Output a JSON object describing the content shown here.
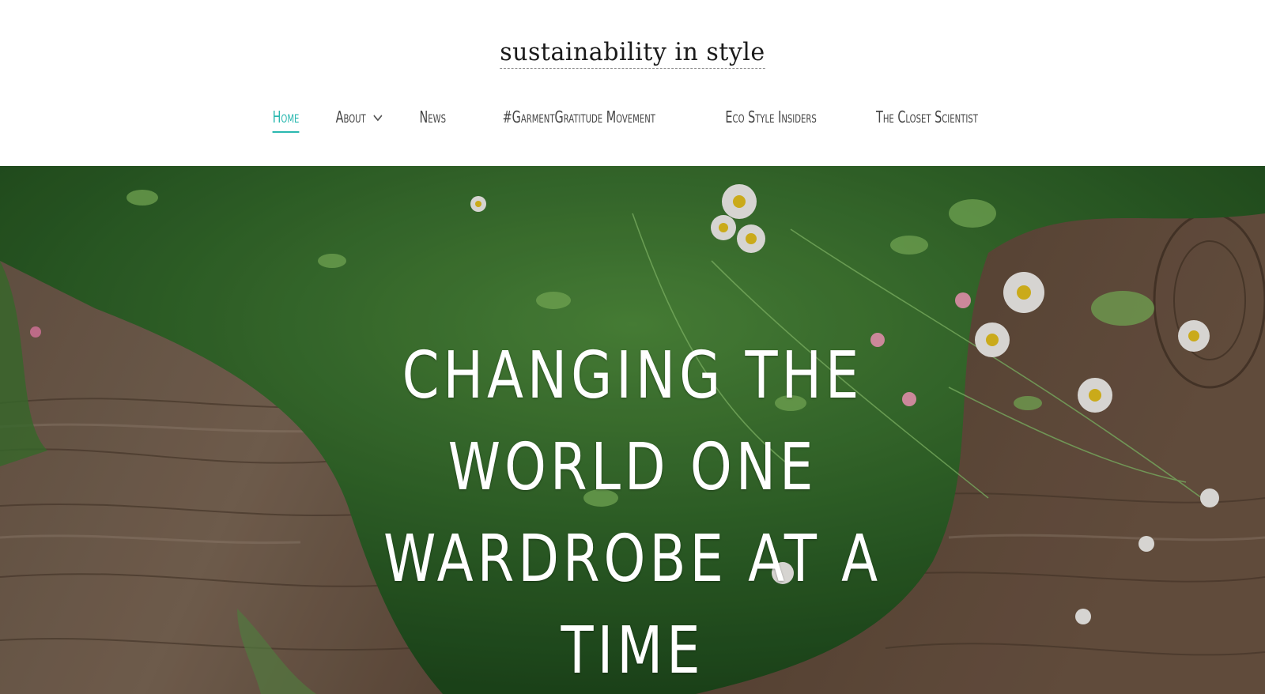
{
  "site": {
    "logo_text": "sustainability in style"
  },
  "nav": {
    "items": [
      {
        "label": "Home",
        "active": true,
        "has_dropdown": false
      },
      {
        "label": "About",
        "active": false,
        "has_dropdown": true
      },
      {
        "label": "News",
        "active": false,
        "has_dropdown": false
      },
      {
        "label": "#GarmentGratitude Movement",
        "active": false,
        "has_dropdown": false
      },
      {
        "label": "Eco Style Insiders",
        "active": false,
        "has_dropdown": false
      },
      {
        "label": "The Closet Scientist",
        "active": false,
        "has_dropdown": false
      }
    ],
    "dropdown_icon": "chevron-down-icon"
  },
  "hero": {
    "title": "Changing the world one wardrobe at a time",
    "background": "plants-on-wood-photo"
  },
  "colors": {
    "accent": "#2ab8b0",
    "nav_text": "#444444",
    "hero_text": "#ffffff"
  }
}
